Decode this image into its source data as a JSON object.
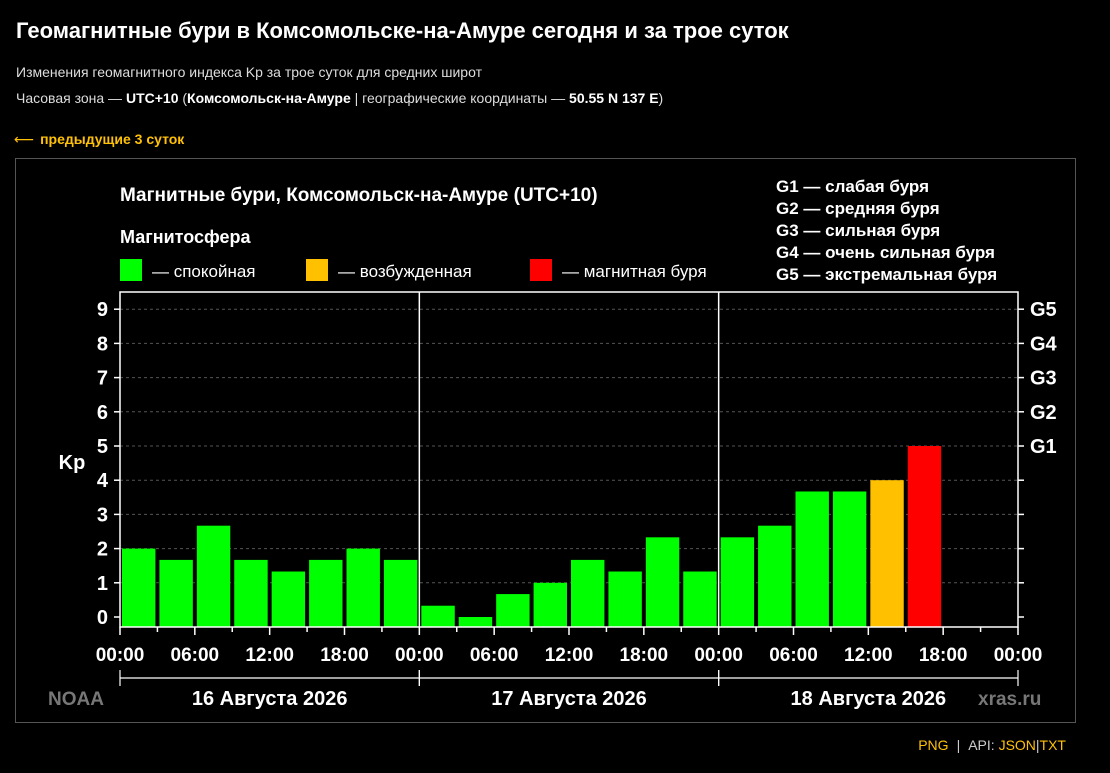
{
  "page": {
    "title": "Геомагнитные бури в Комсомольске-на-Амуре сегодня и за трое суток",
    "subtitle": "Изменения геомагнитного индекса Kp за трое суток для средних широт",
    "tz_prefix": "Часовая зона — ",
    "tz_value": "UTC+10",
    "tz_city_open": " (",
    "tz_city": "Комсомольск-на-Амуре",
    "tz_mid": " | географические координаты — ",
    "tz_coords": "50.55 N 137 E",
    "tz_close": ")",
    "prev_arrow": "⟵",
    "prev_link": "предыдущие 3 суток"
  },
  "footer": {
    "png": "PNG",
    "sep": "|",
    "api_label": "API:",
    "json": "JSON",
    "txt": "TXT"
  },
  "colors": {
    "quiet": "#00ff00",
    "active": "#ffc000",
    "storm": "#ff0000",
    "accent": "#ffc107"
  },
  "chart_data": {
    "type": "bar",
    "title": "Магнитные бури, Комсомольск-на-Амуре (UTC+10)",
    "legend_title": "Магнитосфера",
    "legend": [
      {
        "label": "— спокойная",
        "color": "#00ff00"
      },
      {
        "label": "— возбужденная",
        "color": "#ffc000"
      },
      {
        "label": "— магнитная буря",
        "color": "#ff0000"
      }
    ],
    "storm_scale": [
      "G1 — слабая буря",
      "G2 — средняя буря",
      "G3 — сильная буря",
      "G4 — очень сильная буря",
      "G5 — экстремальная буря"
    ],
    "ylabel": "Kp",
    "ylim": [
      0,
      9
    ],
    "y_ticks": [
      "0",
      "1",
      "2",
      "3",
      "4",
      "5",
      "6",
      "7",
      "8",
      "9"
    ],
    "right_ticks": [
      {
        "label": "G1",
        "y": 5
      },
      {
        "label": "G2",
        "y": 6
      },
      {
        "label": "G3",
        "y": 7
      },
      {
        "label": "G4",
        "y": 8
      },
      {
        "label": "G5",
        "y": 9
      }
    ],
    "x_tick_labels": [
      "00:00",
      "06:00",
      "12:00",
      "18:00",
      "00:00",
      "06:00",
      "12:00",
      "18:00",
      "00:00",
      "06:00",
      "12:00",
      "18:00",
      "00:00"
    ],
    "days": [
      "16 Августа 2026",
      "17 Августа 2026",
      "18 Августа 2026"
    ],
    "watermark_left": "NOAA",
    "watermark_right": "xras.ru",
    "values": [
      2.0,
      1.67,
      2.67,
      1.67,
      1.33,
      1.67,
      2.0,
      1.67,
      0.33,
      0.0,
      0.67,
      1.0,
      1.67,
      1.33,
      2.33,
      1.33,
      2.33,
      2.67,
      3.67,
      3.67,
      4.0,
      5.0
    ],
    "status": [
      "quiet",
      "quiet",
      "quiet",
      "quiet",
      "quiet",
      "quiet",
      "quiet",
      "quiet",
      "quiet",
      "quiet",
      "quiet",
      "quiet",
      "quiet",
      "quiet",
      "quiet",
      "quiet",
      "quiet",
      "quiet",
      "quiet",
      "quiet",
      "active",
      "storm"
    ],
    "grid": true
  }
}
